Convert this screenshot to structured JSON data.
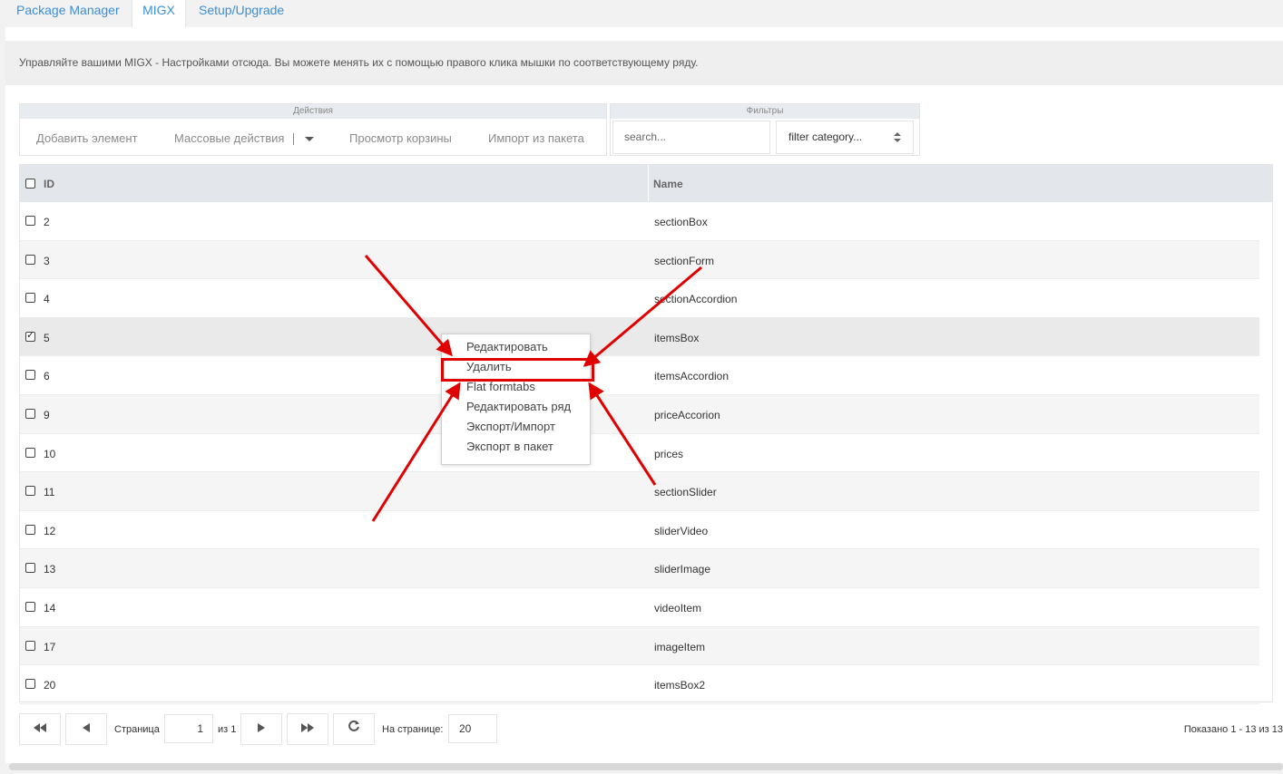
{
  "tabs": [
    {
      "label": "Package Manager"
    },
    {
      "label": "MIGX"
    },
    {
      "label": "Setup/Upgrade"
    }
  ],
  "info_text": "Управляйте вашими MIGX - Настройками отсюда. Вы можете менять их с помощью правого клика мышки по соответствующему ряду.",
  "toolbar": {
    "actions_header": "Действия",
    "add_label": "Добавить элемент",
    "bulk_label": "Массовые действия",
    "trash_label": "Просмотр корзины",
    "import_label": "Импорт из пакета",
    "filters_header": "Фильтры",
    "search_placeholder": "search...",
    "category_select": "filter category..."
  },
  "grid": {
    "headers": {
      "id": "ID",
      "name": "Name"
    },
    "rows": [
      {
        "id": "2",
        "name": "sectionBox",
        "checked": false
      },
      {
        "id": "3",
        "name": "sectionForm",
        "checked": false
      },
      {
        "id": "4",
        "name": "sectionAccordion",
        "checked": false
      },
      {
        "id": "5",
        "name": "itemsBox",
        "checked": true
      },
      {
        "id": "6",
        "name": "itemsAccordion",
        "checked": false
      },
      {
        "id": "9",
        "name": "priceAccorion",
        "checked": false
      },
      {
        "id": "10",
        "name": "prices",
        "checked": false
      },
      {
        "id": "11",
        "name": "sectionSlider",
        "checked": false
      },
      {
        "id": "12",
        "name": "sliderVideo",
        "checked": false
      },
      {
        "id": "13",
        "name": "sliderImage",
        "checked": false
      },
      {
        "id": "14",
        "name": "videoItem",
        "checked": false
      },
      {
        "id": "17",
        "name": "imageItem",
        "checked": false
      },
      {
        "id": "20",
        "name": "itemsBox2",
        "checked": false
      }
    ]
  },
  "context_menu": {
    "items": [
      {
        "label": "Редактировать"
      },
      {
        "label": "Удалить"
      },
      {
        "label": "Flat formtabs"
      },
      {
        "label": "Редактировать ряд"
      },
      {
        "label": "Экспорт/Импорт"
      },
      {
        "label": "Экспорт в пакет"
      }
    ],
    "highlighted_item": "Удалить",
    "annotation_color": "#e10000"
  },
  "paging": {
    "page_label": "Страница",
    "page_value": "1",
    "of_label": "из 1",
    "per_page_label": "На странице:",
    "per_page_value": "20",
    "summary": "Показано 1 - 13 из 13"
  },
  "colors": {
    "tab_link": "#3b8fd6",
    "header_bg": "#e3e7ec",
    "annotation": "#e10000"
  }
}
